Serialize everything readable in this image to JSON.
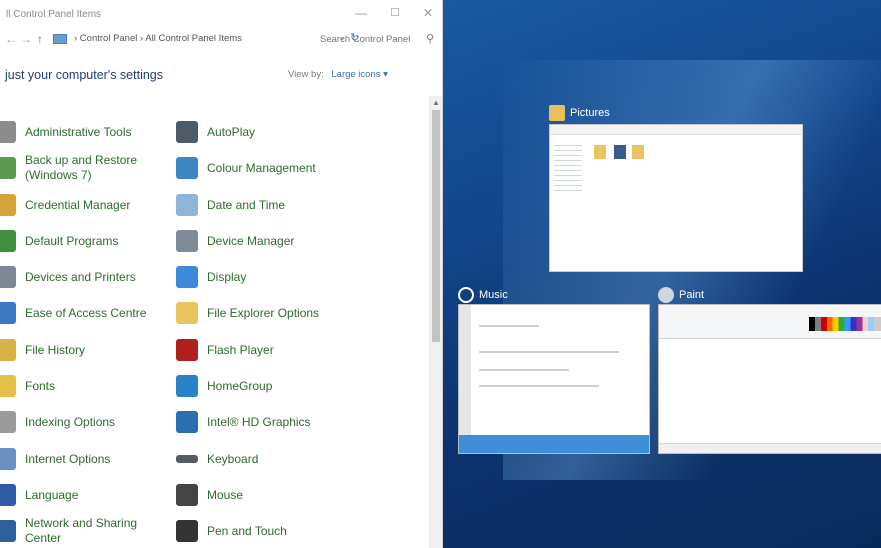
{
  "window": {
    "title": "ll Control Panel Items",
    "minimize": "—",
    "maximize": "☐",
    "close": "✕"
  },
  "address": {
    "crumbs": "› Control Panel  ›  All Control Panel Items",
    "search_placeholder": "Search Control Panel"
  },
  "header": {
    "heading": "just your computer's settings",
    "view_by_label": "View by:",
    "view_by_value": "Large icons ▾"
  },
  "items_left": [
    {
      "label": "Administrative Tools",
      "icon": "administrative-tools-icon"
    },
    {
      "label": "Back up and Restore (Windows 7)",
      "icon": "backup-restore-icon"
    },
    {
      "label": "Credential Manager",
      "icon": "credential-manager-icon"
    },
    {
      "label": "Default Programs",
      "icon": "default-programs-icon"
    },
    {
      "label": "Devices and Printers",
      "icon": "devices-printers-icon"
    },
    {
      "label": "Ease of Access Centre",
      "icon": "ease-of-access-icon"
    },
    {
      "label": "File History",
      "icon": "file-history-icon"
    },
    {
      "label": "Fonts",
      "icon": "fonts-icon"
    },
    {
      "label": "Indexing Options",
      "icon": "indexing-options-icon"
    },
    {
      "label": "Internet Options",
      "icon": "internet-options-icon"
    },
    {
      "label": "Language",
      "icon": "language-icon"
    },
    {
      "label": "Network and Sharing Center",
      "icon": "network-sharing-icon"
    }
  ],
  "items_right": [
    {
      "label": "AutoPlay",
      "icon": "autoplay-icon"
    },
    {
      "label": "Colour Management",
      "icon": "colour-management-icon"
    },
    {
      "label": "Date and Time",
      "icon": "date-time-icon"
    },
    {
      "label": "Device Manager",
      "icon": "device-manager-icon"
    },
    {
      "label": "Display",
      "icon": "display-icon"
    },
    {
      "label": "File Explorer Options",
      "icon": "file-explorer-options-icon"
    },
    {
      "label": "Flash Player",
      "icon": "flash-player-icon"
    },
    {
      "label": "HomeGroup",
      "icon": "homegroup-icon"
    },
    {
      "label": "Intel® HD Graphics",
      "icon": "intel-hd-graphics-icon"
    },
    {
      "label": "Keyboard",
      "icon": "keyboard-icon"
    },
    {
      "label": "Mouse",
      "icon": "mouse-icon"
    },
    {
      "label": "Pen and Touch",
      "icon": "pen-touch-icon"
    }
  ],
  "taskview": {
    "pictures": "Pictures",
    "music": "Music",
    "paint": "Paint"
  }
}
